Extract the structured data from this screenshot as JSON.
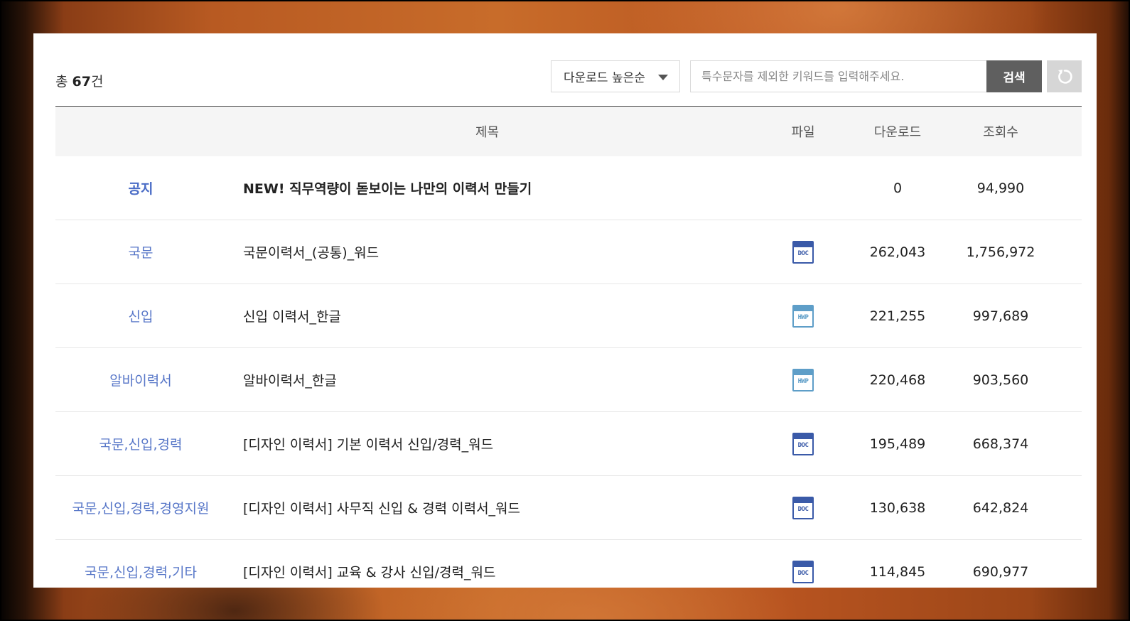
{
  "summary": {
    "prefix": "총 ",
    "count": "67",
    "suffix": "건"
  },
  "sort": {
    "selected": "다운로드 높은순"
  },
  "search": {
    "placeholder": "특수문자를 제외한 키워드를 입력해주세요.",
    "value": "",
    "button_label": "검색"
  },
  "table": {
    "headers": {
      "title": "제목",
      "file": "파일",
      "downloads": "다운로드",
      "views": "조회수"
    },
    "notice": {
      "category": "공지",
      "title": "NEW! 직무역량이 돋보이는 나만의 이력서 만들기",
      "downloads": "0",
      "views": "94,990"
    },
    "rows": [
      {
        "category": "국문",
        "title": "국문이력서_(공통)_워드",
        "file_type": "DOC",
        "downloads": "262,043",
        "views": "1,756,972"
      },
      {
        "category": "신입",
        "title": "신입 이력서_한글",
        "file_type": "HWP",
        "downloads": "221,255",
        "views": "997,689"
      },
      {
        "category": "알바이력서",
        "title": "알바이력서_한글",
        "file_type": "HWP",
        "downloads": "220,468",
        "views": "903,560"
      },
      {
        "category": "국문,신입,경력",
        "title": "[디자인 이력서] 기본 이력서 신입/경력_워드",
        "file_type": "DOC",
        "downloads": "195,489",
        "views": "668,374"
      },
      {
        "category": "국문,신입,경력,경영지원",
        "title": "[디자인 이력서] 사무직 신입 & 경력 이력서_워드",
        "file_type": "DOC",
        "downloads": "130,638",
        "views": "642,824"
      },
      {
        "category": "국문,신입,경력,기타",
        "title": "[디자인 이력서] 교육 & 강사 신입/경력_워드",
        "file_type": "DOC",
        "downloads": "114,845",
        "views": "690,977"
      }
    ]
  },
  "colors": {
    "accent_link": "#5877c8",
    "search_button": "#5f5f5f",
    "doc_icon": "#3a5aa8",
    "hwp_icon": "#5e9ec8"
  },
  "icons": {
    "sort": "caret-down-icon",
    "reset": "refresh-icon",
    "doc": "doc-file-icon",
    "hwp": "hwp-file-icon"
  }
}
